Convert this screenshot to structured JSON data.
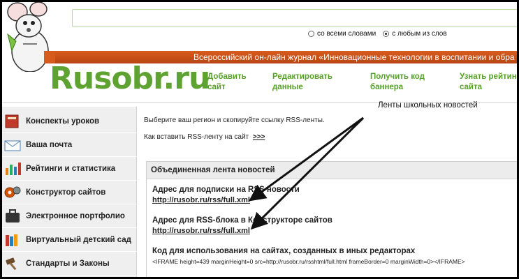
{
  "search": {
    "option_all": "со всеми словами",
    "option_any": "с любым из слов",
    "selected": "с любым из слов"
  },
  "banner": {
    "text": "Всероссийский он-лайн журнал «Инновационные технологии в воспитании и обра"
  },
  "logo": {
    "text": "Rusobr.ru"
  },
  "nav": [
    {
      "line1": "Добавить",
      "line2": "сайт"
    },
    {
      "line1": "Редактировать",
      "line2": "данные"
    },
    {
      "line1": "Получить код",
      "line2": "баннера"
    },
    {
      "line1": "Узнать рейтин",
      "line2": "сайта"
    }
  ],
  "sidebar": {
    "items": [
      {
        "label": "Конспекты уроков",
        "icon": "notebook-icon"
      },
      {
        "label": "Ваша почта",
        "icon": "mail-icon"
      },
      {
        "label": "Рейтинги и статистика",
        "icon": "bar-chart-icon"
      },
      {
        "label": "Конструктор сайтов",
        "icon": "gears-icon"
      },
      {
        "label": "Электронное портфолио",
        "icon": "briefcase-icon"
      },
      {
        "label": "Виртуальный детский сад",
        "icon": "books-icon"
      },
      {
        "label": "Стандарты и Законы",
        "icon": "gavel-icon"
      }
    ]
  },
  "main": {
    "intro": "Выберите ваш регион и скопируйте ссылку RSS-ленты.",
    "howto_text": "Как вставить RSS-ленту на сайт",
    "howto_link": ">>>",
    "annotation": "Ленты школьных новостей",
    "panel": {
      "title": "Объединенная лента новостей",
      "subscribe_title": "Адрес для подписки на RSS новости",
      "subscribe_url": "http://rusobr.ru/rss/full.xml",
      "block_title": "Адрес для RSS-блока в Конструкторе сайтов",
      "block_url": "http://rusobr.ru/rss/full.xml",
      "code_title": "Код для использования на сайтах, созданных в иных редакторах",
      "code": "<IFRAME height=439 marginHeight=0 src=http://rusobr.ru/rsshtml/full.html frameBorder=0 marginWidth=0></IFRAME>"
    }
  },
  "colors": {
    "brand_green": "#5ea332",
    "banner_orange": "#d85b1e",
    "sidebar_bg": "#efefef"
  }
}
